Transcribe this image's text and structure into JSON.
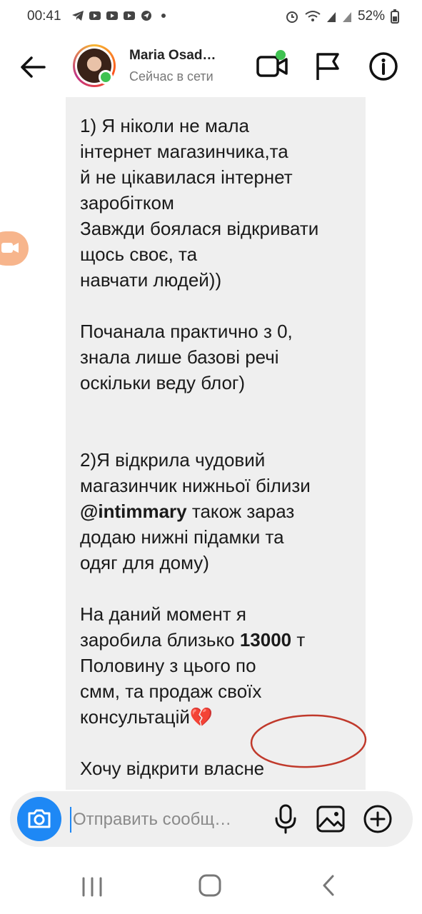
{
  "status_bar": {
    "time": "00:41",
    "battery": "52%",
    "left_icons": [
      "telegram-icon",
      "youtube-icon",
      "youtube-icon",
      "youtube-icon",
      "navigation-icon",
      "dot-icon"
    ],
    "right_icons": [
      "alarm-icon",
      "wifi-icon",
      "signal-icon",
      "signal-icon",
      "battery-icon"
    ]
  },
  "header": {
    "name": "Maria Osad…",
    "status": "Сейчас в сети",
    "online_color": "#3fc251"
  },
  "message": {
    "lines_1": "1) Я ніколи не мала\nінтернет магазинчика,та\nй не цікавилася інтернет\nзаробітком\nЗавжди боялася відкривати\nщось своє, та\nнавчати людей))",
    "lines_2": "Почанала практично з 0,\nзнала лише базові речі\nоскільки веду блог)",
    "lines_3": "2)Я відкрила чудовий\nмагазинчик нижньої білизи",
    "mention": "@intimmary",
    "lines_4a": " також зараз",
    "lines_4b": "додаю нижні підамки та\nодяг для дому)",
    "lines_5a": "На даний момент я\nзаробила близько ",
    "amount": "13000",
    "lines_5b": " т",
    "lines_6": "Половину з цього по\nсмм, та продаж своїх\nконсультацій💔",
    "lines_7": "Хочу відкрити власне"
  },
  "composer": {
    "placeholder": "Отправить сообщ…",
    "accent": "#1e88f5"
  },
  "colors": {
    "bubble": "#efefef",
    "annotation": "#c0392b"
  }
}
